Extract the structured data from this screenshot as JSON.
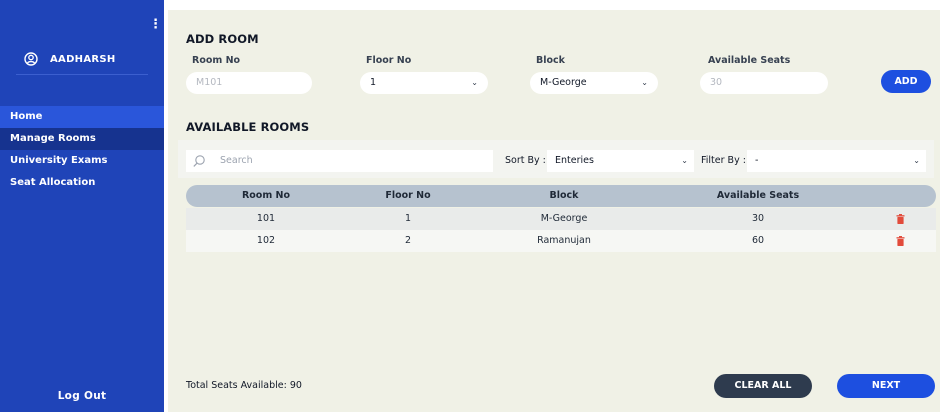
{
  "sidebar": {
    "username": "AADHARSH",
    "items": [
      {
        "label": "Home"
      },
      {
        "label": "Manage Rooms"
      },
      {
        "label": "University Exams"
      },
      {
        "label": "Seat Allocation"
      }
    ],
    "logout": "Log Out"
  },
  "add_room": {
    "title": "ADD ROOM",
    "room_no_label": "Room No",
    "room_no_placeholder": "M101",
    "floor_label": "Floor No",
    "floor_value": "1",
    "block_label": "Block",
    "block_value": "M-George",
    "seats_label": "Available Seats",
    "seats_placeholder": "30",
    "add_button": "ADD"
  },
  "rooms": {
    "title": "AVAILABLE ROOMS",
    "search_placeholder": "Search",
    "sort_label": "Sort By :",
    "sort_value": "Enteries",
    "filter_label": "Filter By :",
    "filter_value": "-",
    "columns": [
      "Room No",
      "Floor No",
      "Block",
      "Available Seats"
    ],
    "rows": [
      {
        "room": "101",
        "floor": "1",
        "block": "M-George",
        "seats": "30"
      },
      {
        "room": "102",
        "floor": "2",
        "block": "Ramanujan",
        "seats": "60"
      }
    ]
  },
  "footer": {
    "total": "Total Seats Available: 90",
    "clear_all": "CLEAR ALL",
    "next": "NEXT"
  },
  "colors": {
    "sidebar": "#1f44b8",
    "primary": "#1d4fe0",
    "dark_button": "#2e3b4e",
    "delete": "#e24b3b"
  },
  "icons": [
    "kebab-menu-icon",
    "user-circle-icon",
    "search-icon",
    "chevron-down-icon",
    "trash-icon"
  ]
}
